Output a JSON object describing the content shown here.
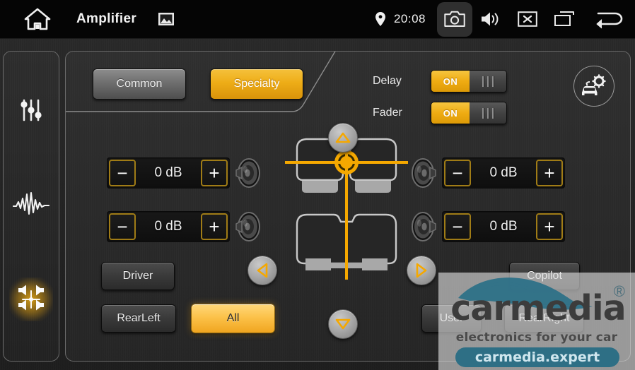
{
  "topbar": {
    "home_icon": "home-icon",
    "title": "Amplifier",
    "image_icon": "image-icon",
    "location_icon": "location-pin-icon",
    "time": "20:08",
    "camera_icon": "camera-icon",
    "volume_icon": "volume-icon",
    "close_icon": "close-box-icon",
    "recents_icon": "recent-apps-icon",
    "back_icon": "back-arrow-icon"
  },
  "sidebar": {
    "items": [
      {
        "name": "equalizer-sliders-icon",
        "active": false
      },
      {
        "name": "waveform-icon",
        "active": false
      },
      {
        "name": "balance-speakers-icon",
        "active": true
      }
    ]
  },
  "tabs": [
    {
      "label": "Common",
      "active": false
    },
    {
      "label": "Specialty",
      "active": true
    }
  ],
  "switches": [
    {
      "label": "Delay",
      "state": "ON"
    },
    {
      "label": "Fader",
      "state": "ON"
    }
  ],
  "car_settings_icon": "car-gear-icon",
  "levels": {
    "minus": "−",
    "plus": "+",
    "front_left": "0 dB",
    "rear_left": "0 dB",
    "front_right": "0 dB",
    "rear_right": "0 dB"
  },
  "nav": {
    "up": "up-arrow-icon",
    "down": "down-arrow-icon",
    "left": "left-arrow-icon",
    "right": "right-arrow-icon"
  },
  "presets": [
    {
      "label": "Driver",
      "active": false
    },
    {
      "label": "RearLeft",
      "active": false
    },
    {
      "label": "All",
      "active": true
    },
    {
      "label": "Copilot",
      "active": false
    },
    {
      "label": "User",
      "active": false
    },
    {
      "label": "RearRight",
      "active": false
    }
  ],
  "watermark": {
    "brand": "carmedia",
    "registered": "®",
    "tagline": "electronics for your car",
    "site": "carmedia.expert"
  },
  "colors": {
    "accent": "#eead17",
    "accent_light": "#fcc24a",
    "panel_bg": "#2b2b2b",
    "topbar_bg": "#050505",
    "border": "#6a6a6a",
    "watermark_teal": "#2e6f85"
  }
}
